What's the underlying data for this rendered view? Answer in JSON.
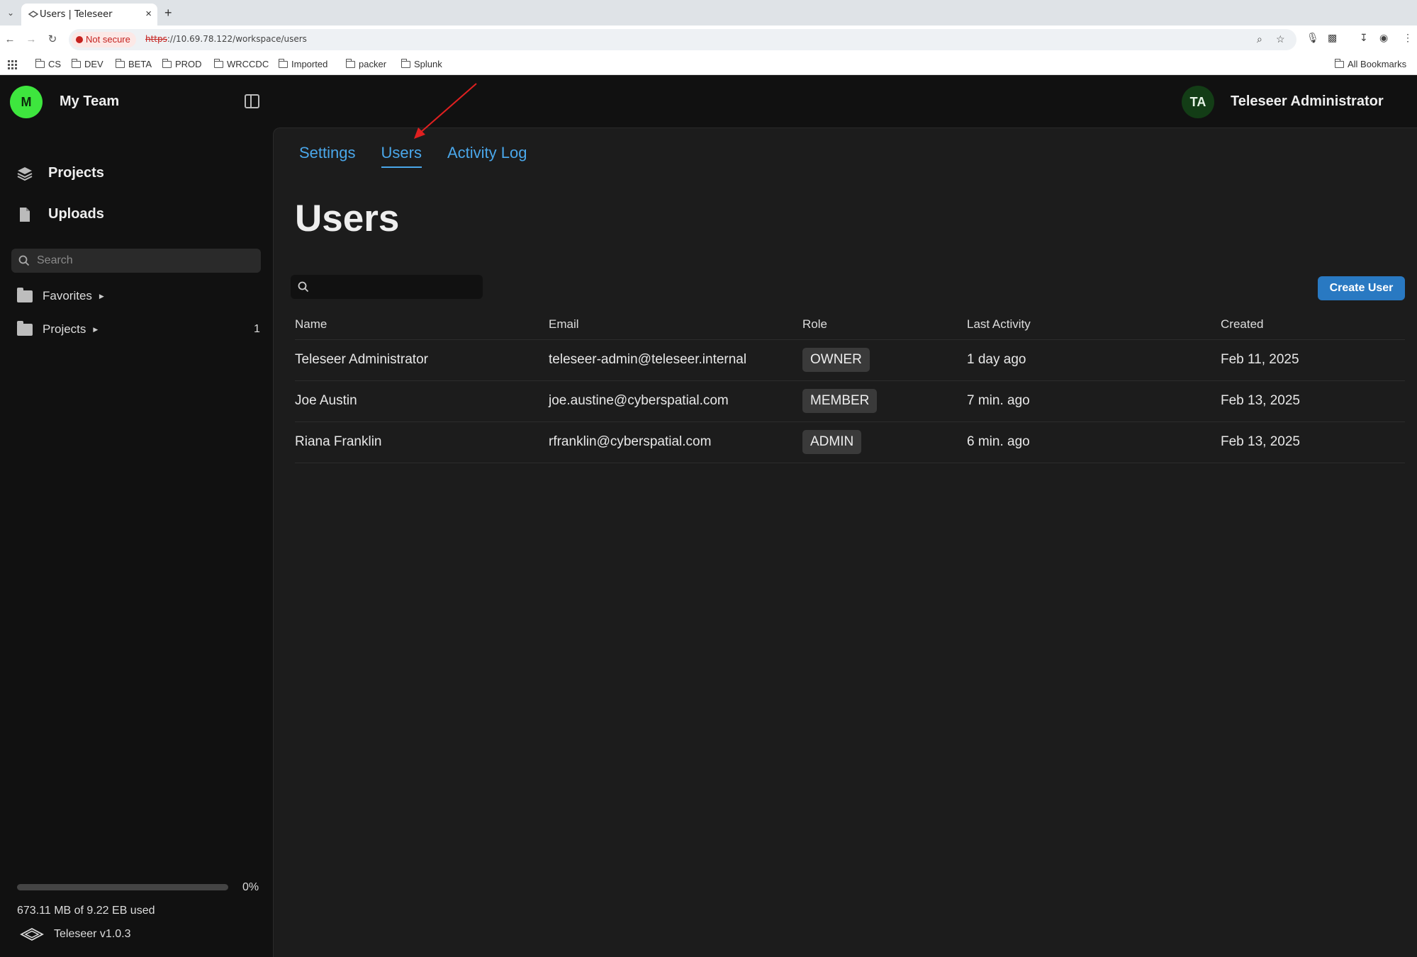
{
  "browser": {
    "tab_title": "Users | Teleseer",
    "not_secure": "Not secure",
    "url_scheme": "https",
    "url_rest": "://10.69.78.122/workspace/users",
    "bookmarks": [
      "CS",
      "DEV",
      "BETA",
      "PROD",
      "WRCCDC",
      "Imported",
      "packer",
      "Splunk"
    ],
    "all_bookmarks": "All Bookmarks"
  },
  "team": {
    "initial": "M",
    "name": "My Team"
  },
  "user": {
    "initials": "TA",
    "name": "Teleseer Administrator"
  },
  "sidebar": {
    "nav": [
      {
        "label": "Projects",
        "icon": "layers-icon"
      },
      {
        "label": "Uploads",
        "icon": "file-icon"
      }
    ],
    "search_placeholder": "Search",
    "tree": [
      {
        "label": "Favorites",
        "count": ""
      },
      {
        "label": "Projects",
        "count": "1"
      }
    ],
    "storage": {
      "percent_label": "0%",
      "fraction": 0,
      "used_text": "673.11 MB of 9.22 EB used"
    },
    "version": "Teleseer v1.0.3"
  },
  "main": {
    "tabs": [
      {
        "label": "Settings",
        "active": false
      },
      {
        "label": "Users",
        "active": true
      },
      {
        "label": "Activity Log",
        "active": false
      }
    ],
    "title": "Users",
    "search_value": "",
    "create_button": "Create User",
    "columns": [
      "Name",
      "Email",
      "Role",
      "Last Activity",
      "Created"
    ],
    "rows": [
      {
        "name": "Teleseer Administrator",
        "email": "teleseer-admin@teleseer.internal",
        "role": "OWNER",
        "last_activity": "1 day ago",
        "created": "Feb 11, 2025"
      },
      {
        "name": "Joe Austin",
        "email": "joe.austine@cyberspatial.com",
        "role": "MEMBER",
        "last_activity": "7 min. ago",
        "created": "Feb 13, 2025"
      },
      {
        "name": "Riana Franklin",
        "email": "rfranklin@cyberspatial.com",
        "role": "ADMIN",
        "last_activity": "6 min. ago",
        "created": "Feb 13, 2025"
      }
    ]
  },
  "colors": {
    "accent": "#4aa7ea",
    "button": "#2979c2",
    "team_avatar": "#3ee63e",
    "user_avatar": "#133d16",
    "annotation_arrow": "#e02020"
  }
}
